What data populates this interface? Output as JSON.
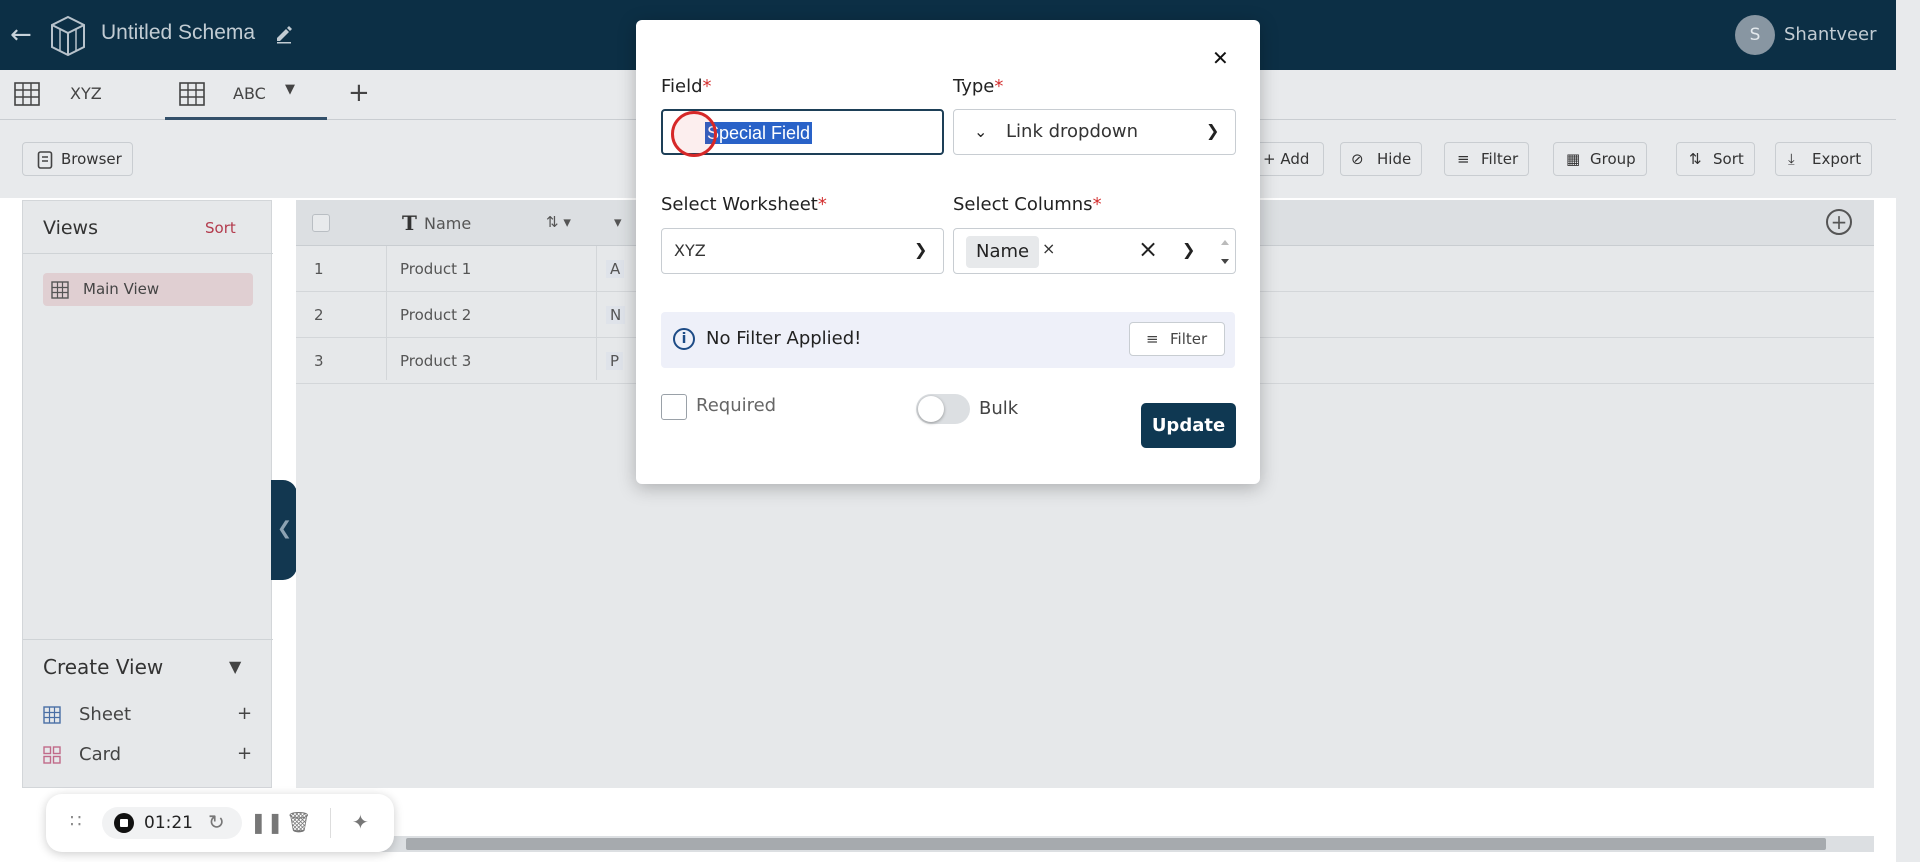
{
  "header": {
    "title": "Untitled Schema",
    "user_initial": "S",
    "user_name": "Shantveer"
  },
  "tabs": [
    {
      "label": "XYZ",
      "active": false
    },
    {
      "label": "ABC",
      "active": true
    }
  ],
  "toolbar": {
    "browser": "Browser",
    "add": "+ Add",
    "hide": "Hide",
    "filter": "Filter",
    "group": "Group",
    "sort": "Sort",
    "export": "Export"
  },
  "sidebar": {
    "views_title": "Views",
    "views_sort": "Sort",
    "views": [
      {
        "label": "Main View"
      }
    ],
    "create_view_title": "Create View",
    "create_items": [
      {
        "label": "Sheet"
      },
      {
        "label": "Card"
      }
    ]
  },
  "grid": {
    "columns": [
      {
        "label": "Name"
      }
    ],
    "rows": [
      {
        "num": "1",
        "name": "Product 1",
        "next_peek": "A"
      },
      {
        "num": "2",
        "name": "Product 2",
        "next_peek": "N"
      },
      {
        "num": "3",
        "name": "Product 3",
        "next_peek": "P"
      }
    ]
  },
  "modal": {
    "field_label": "Field",
    "field_value": "Special Field",
    "type_label": "Type",
    "type_value": "Link dropdown",
    "worksheet_label": "Select Worksheet",
    "worksheet_value": "XYZ",
    "columns_label": "Select Columns",
    "columns_chips": [
      "Name"
    ],
    "required_mark": "*",
    "notice_text": "No Filter Applied!",
    "notice_button": "Filter",
    "required_label": "Required",
    "bulk_label": "Bulk",
    "update_button": "Update"
  },
  "recorder": {
    "time": "01:21"
  },
  "colors": {
    "header_bg": "#0c2f45",
    "primary_button": "#0f3852",
    "selection": "#2962c8",
    "required_star": "#d32f2f",
    "sort_link": "#b33b4d"
  }
}
